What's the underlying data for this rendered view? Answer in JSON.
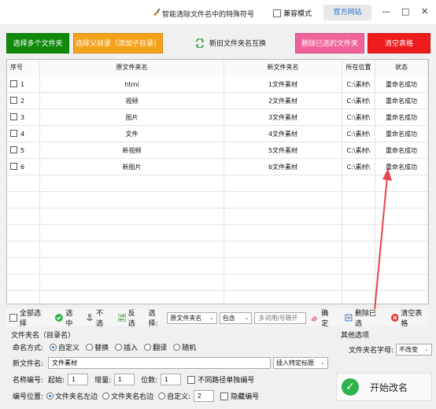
{
  "titlebar": {
    "title": "智能清除文件名中的特殊符号",
    "compat_label": "兼容模式",
    "official_label": "官方网站",
    "min_glyph": "—",
    "max_glyph": "□",
    "close_glyph": "✕"
  },
  "toolbar": {
    "select_folders": "选择多个文件夹",
    "select_parent": "选择父目录（添加子目录）",
    "swap_names": "新旧文件夹名互换",
    "delete_selected": "删除已选的文件夹",
    "clear_table": "清空表格"
  },
  "colors": {
    "green": "#118a0c",
    "orange": "#f5a21b",
    "pink": "#f0629a",
    "red": "#ee1c1c"
  },
  "table": {
    "headers": [
      "序号",
      "原文件夹名",
      "新文件夹名",
      "所在位置",
      "状态"
    ],
    "rows": [
      {
        "no": "1",
        "old": "html",
        "new": "1文件素材",
        "loc": "C:\\素材\\",
        "status": "重命名成功"
      },
      {
        "no": "2",
        "old": "视频",
        "new": "2文件素材",
        "loc": "C:\\素材\\",
        "status": "重命名成功"
      },
      {
        "no": "3",
        "old": "图片",
        "new": "3文件素材",
        "loc": "C:\\素材\\",
        "status": "重命名成功"
      },
      {
        "no": "4",
        "old": "文件",
        "new": "4文件素材",
        "loc": "C:\\素材\\",
        "status": "重命名成功"
      },
      {
        "no": "5",
        "old": "新视频",
        "new": "5文件素材",
        "loc": "C:\\素材\\",
        "status": "重命名成功"
      },
      {
        "no": "6",
        "old": "新图片",
        "new": "6文件素材",
        "loc": "C:\\素材\\",
        "status": "重命名成功"
      }
    ]
  },
  "bar": {
    "select_all": "全部选择",
    "check": "选中",
    "uncheck": "不选",
    "invert": "反选",
    "choose_label": "选择:",
    "field_value": "原文件夹名",
    "match_value": "包含",
    "keyword_placeholder": "多词用|号隔开",
    "confirm": "确定",
    "delete_checked": "删除已选",
    "clear": "清空表格"
  },
  "options": {
    "title": "文件夹名（目录名）",
    "mode_label": "命名方式:",
    "modes": [
      "自定义",
      "替换",
      "插入",
      "翻译",
      "随机"
    ],
    "new_name_label": "新文件名:",
    "new_name_value": "文件素材",
    "insert_select": "插入特定标题",
    "num_label": "名称编号:",
    "start_label": "起始:",
    "start_value": "1",
    "step_label": "增量:",
    "step_value": "1",
    "digits_label": "位数:",
    "digits_value": "1",
    "diff_path_label": "不同路径单独编号",
    "pos_label": "编号位置:",
    "pos_left": "文件夹名左边",
    "pos_right": "文件夹名右边",
    "pos_custom": "自定义:",
    "pos_custom_value": "2",
    "hide_num_label": "隐藏编号"
  },
  "other": {
    "title": "其他选项",
    "case_label": "文件夹名字母:",
    "case_value": "不改变",
    "start_button": "开始改名"
  }
}
